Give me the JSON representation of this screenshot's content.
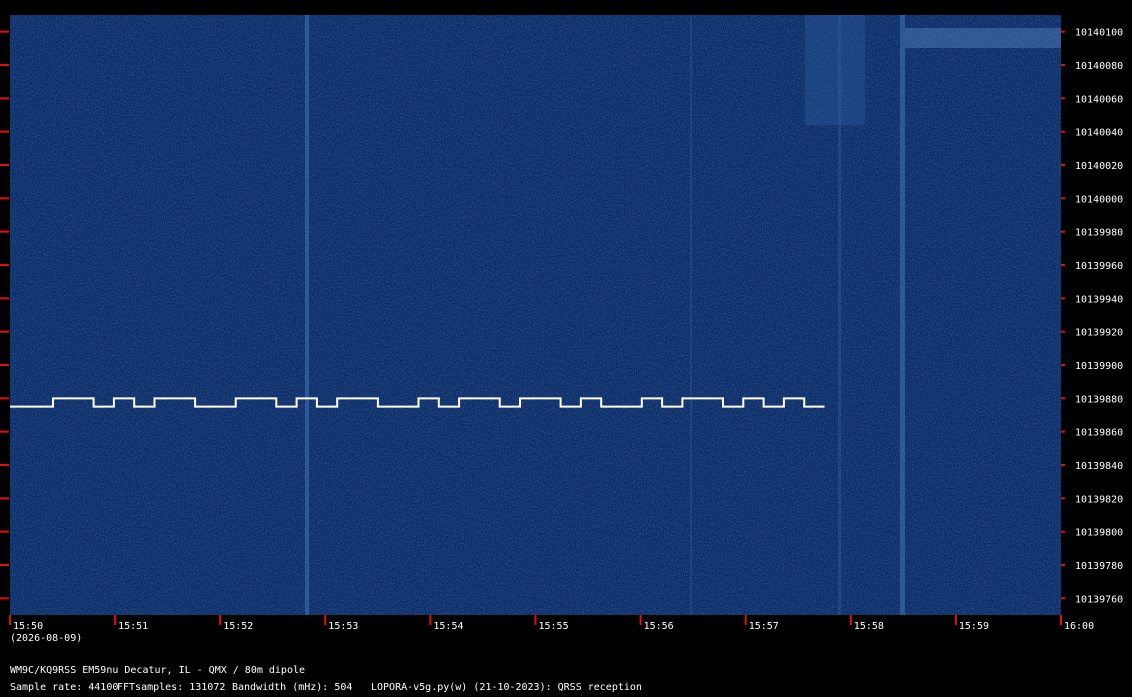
{
  "plot": {
    "background_color": "#0c2a63",
    "signal_color": "#ffffff",
    "marker_color": "#e01010",
    "freq_min_hz": 10139750,
    "freq_max_hz": 10140110,
    "freq_ticks": [
      "10140100",
      "10140080",
      "10140060",
      "10140040",
      "10140020",
      "10140000",
      "10139980",
      "10139960",
      "10139940",
      "10139920",
      "10139900",
      "10139880",
      "10139860",
      "10139840",
      "10139820",
      "10139800",
      "10139780",
      "10139760"
    ],
    "time_ticks": [
      "15:50",
      "15:51",
      "15:52",
      "15:53",
      "15:54",
      "15:55",
      "15:56",
      "15:57",
      "15:58",
      "15:59",
      "16:00"
    ],
    "date_label": "(2026-08-09)",
    "carrier_line_hz": 10140000,
    "signal_base_hz": 10139875,
    "signal_high_hz": 10139880,
    "signal_end_time": "15:57:45",
    "time_start": "15:50",
    "time_end": "16:00"
  },
  "footer": {
    "station": "WM9C/KQ9RSS EM59nu Decatur, IL - QMX / 80m dipole",
    "sample_rate": "Sample rate: 44100",
    "fft_samples": "FFTsamples: 131072",
    "bandwidth": "Bandwidth (mHz): 504",
    "software": "LOPORA-v5g.py(w) (21-10-2023): QRSS reception"
  }
}
